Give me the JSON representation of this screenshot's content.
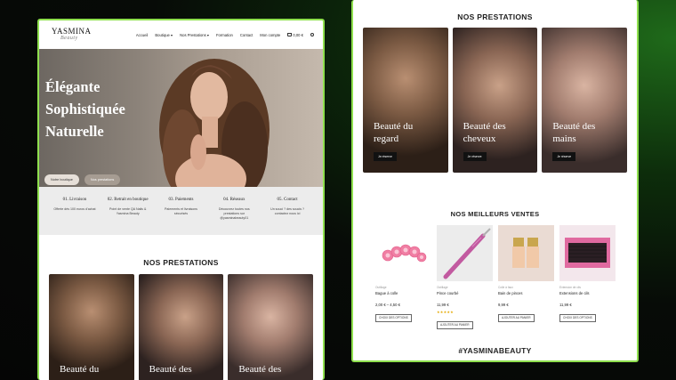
{
  "header": {
    "logo_main": "YASMINA",
    "logo_sub": "Beauty",
    "nav": [
      "Accueil",
      "Boutique",
      "Nos Prestations",
      "Formation",
      "Contact",
      "Mon compte"
    ],
    "cart_total": "0,00 €"
  },
  "hero": {
    "lines": [
      "Élégante",
      "Sophistiquée",
      "Naturelle"
    ],
    "button_shop": "Notre boutique",
    "button_services": "Nos prestations"
  },
  "features": [
    {
      "title": "01. Livraison",
      "desc": "Offerte dès 100 euros d'achat"
    },
    {
      "title": "02. Retrait en boutique",
      "desc": "Point de vente QA Nails & Yasmina Beauty"
    },
    {
      "title": "03. Paiements",
      "desc": "Paiements et livraisons sécurisés"
    },
    {
      "title": "04. Réseaux",
      "desc": "Découvrez toutes nos prestations sur @yasminabeauty01"
    },
    {
      "title": "05. Contact",
      "desc": "Un souci ? des soucis ? contactez nous ici"
    }
  ],
  "services": {
    "title": "NOS PRESTATIONS",
    "button": "Je réserve",
    "cards": [
      {
        "l1": "Beauté du",
        "l2": "regard"
      },
      {
        "l1": "Beauté des",
        "l2": "cheveux"
      },
      {
        "l1": "Beauté des",
        "l2": "mains"
      }
    ]
  },
  "bestsellers": {
    "title": "NOS MEILLEURS VENTES",
    "products": [
      {
        "cat": "Outillage",
        "name": "Bague à colle",
        "price": "2,00 € – 4,50 €",
        "button": "CHOIX DES OPTIONS",
        "stars": ""
      },
      {
        "cat": "Outillage",
        "name": "Pince courbé",
        "price": "11,99 €",
        "button": "AJOUTER AU PANIER",
        "stars": "★★★★★"
      },
      {
        "cat": "Colle à faux",
        "name": "Bain de pinces",
        "price": "9,99 €",
        "button": "AJOUTER AU PANIER",
        "stars": ""
      },
      {
        "cat": "Extension de cils",
        "name": "Extensions de cils",
        "price": "11,99 €",
        "button": "CHOIX DES OPTIONS",
        "stars": ""
      }
    ]
  },
  "hashtag": "#YASMINABEAUTY",
  "colors": {
    "frame_border": "#8fe04e",
    "feature_bg": "#ececec",
    "hero_bg": "#8c837a",
    "star": "#e4a900"
  }
}
